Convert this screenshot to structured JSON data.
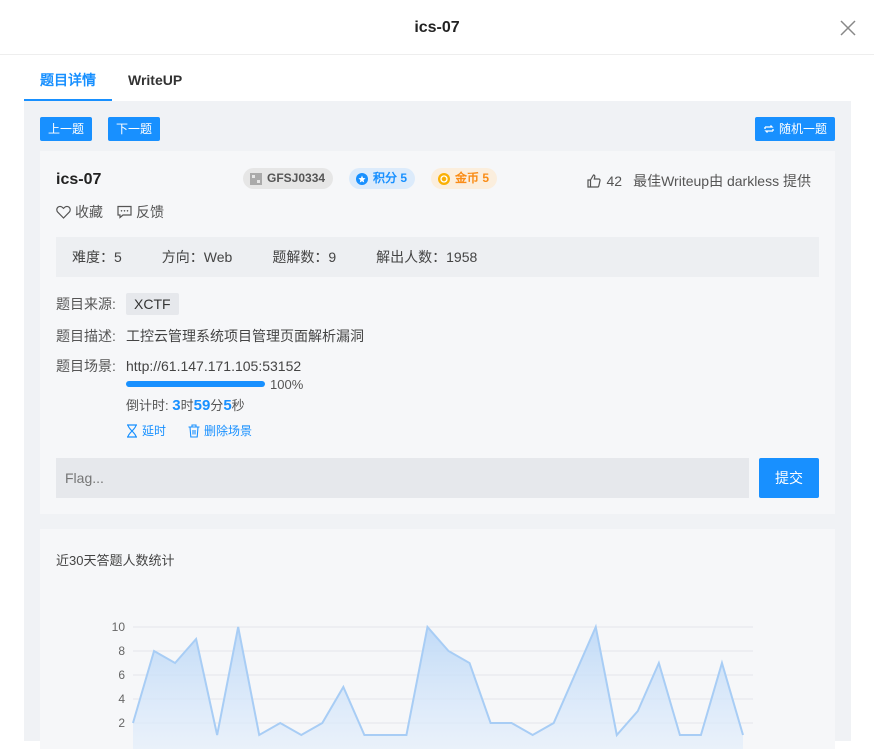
{
  "window": {
    "title": "ics-07"
  },
  "tabs": [
    {
      "label": "题目详情",
      "active": true
    },
    {
      "label": "WriteUP",
      "active": false
    }
  ],
  "toolbar": {
    "prev_label": "上一题",
    "next_label": "下一题",
    "random_label": "随机一题"
  },
  "challenge": {
    "name": "ics-07",
    "id_tag": "GFSJ0334",
    "score_tag": "积分 5",
    "gold_tag": "金币 5",
    "likes": "42",
    "best_writeup": "最佳Writeup由 darkless 提供",
    "collect_label": "收藏",
    "feedback_label": "反馈",
    "difficulty": "难度：5",
    "direction": "方向：Web",
    "solutions": "题解数：9",
    "solvers": "解出人数：1958",
    "source_label": "题目来源:",
    "source_value": "XCTF",
    "desc_label": "题目描述:",
    "desc_value": "工控云管理系统项目管理页面解析漏洞",
    "scene_label": "题目场景:",
    "scene_url": "http://61.147.171.105:53152",
    "progress": 1.0,
    "progress_text": "100%",
    "countdown_label": "倒计时:",
    "countdown_h": "3",
    "countdown_h_unit": "时",
    "countdown_m": "59",
    "countdown_m_unit": "分",
    "countdown_s": "5",
    "countdown_s_unit": "秒",
    "extend_label": "延时",
    "delete_label": "删除场景",
    "flag_placeholder": "Flag...",
    "submit_label": "提交"
  },
  "colors": {
    "accent": "#1890ff",
    "gold": "#fa8c16",
    "panel_bg": "#f0f2f5"
  },
  "chart_data": {
    "type": "area",
    "title": "近30天答题人数统计",
    "ylim": [
      0,
      10
    ],
    "yticks": [
      2,
      4,
      6,
      8,
      10
    ],
    "x": [
      1,
      2,
      3,
      4,
      5,
      6,
      7,
      8,
      9,
      10,
      11,
      12,
      13,
      14,
      15,
      16,
      17,
      18,
      19,
      20,
      21,
      22,
      23,
      24,
      25,
      26,
      27,
      28,
      29,
      30
    ],
    "values": [
      2,
      8,
      7,
      9,
      1,
      10,
      1,
      2,
      1,
      2,
      5,
      1,
      1,
      1,
      10,
      8,
      7,
      2,
      2,
      1,
      2,
      6,
      10,
      1,
      3,
      7,
      1,
      1,
      7,
      1
    ],
    "color": "#a8cdf5"
  }
}
